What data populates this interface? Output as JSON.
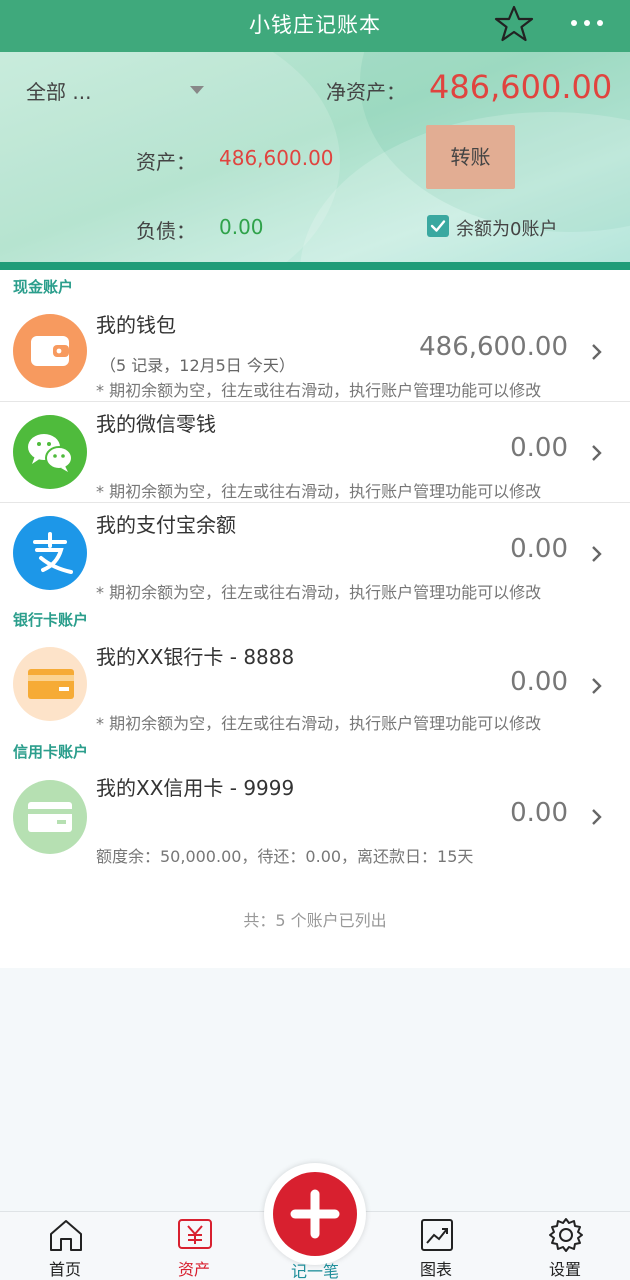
{
  "header": {
    "title": "小钱庄记账本",
    "favorite_icon": "star-icon",
    "more_icon": "more-icon"
  },
  "summary": {
    "filter_label": "全部 ...",
    "net_assets_label": "净资产：",
    "net_assets_value": "486,600.00",
    "assets_label": "资产：",
    "assets_value": "486,600.00",
    "transfer_label": "转账",
    "debt_label": "负债：",
    "debt_value": "0.00",
    "zero_balance_label": "余额为0账户",
    "zero_balance_checked": true
  },
  "sections": {
    "cash": "现金账户",
    "bank": "银行卡账户",
    "credit": "信用卡账户"
  },
  "accounts": [
    {
      "name": "我的钱包",
      "sub": "（5 记录，12月5日 今天）",
      "amount": "486,600.00",
      "note": "* 期初余额为空，往左或往右滑动，执行账户管理功能可以修改",
      "icon": "wallet-icon",
      "color": "#f79a5f"
    },
    {
      "name": "我的微信零钱",
      "amount": "0.00",
      "note": "* 期初余额为空，往左或往右滑动，执行账户管理功能可以修改",
      "icon": "wechat-icon",
      "color": "#4fbb3c"
    },
    {
      "name": "我的支付宝余额",
      "amount": "0.00",
      "note": "* 期初余额为空，往左或往右滑动，执行账户管理功能可以修改",
      "icon": "alipay-icon",
      "color": "#1d97e8"
    },
    {
      "name": "我的XX银行卡 - 8888",
      "amount": "0.00",
      "note": "* 期初余额为空，往左或往右滑动，执行账户管理功能可以修改",
      "icon": "bank-card-icon",
      "color": "#fde3c9"
    },
    {
      "name": "我的XX信用卡 - 9999",
      "amount": "0.00",
      "note": "额度余：50,000.00，待还：0.00，离还款日：15天",
      "icon": "credit-card-icon",
      "color": "#b6e0b2"
    }
  ],
  "footer": {
    "count_text": "共：5 个账户已列出"
  },
  "nav": {
    "home": "首页",
    "assets": "资产",
    "add": "记一笔",
    "charts": "图表",
    "settings": "设置",
    "active": "assets"
  },
  "colors": {
    "brand_green": "#3fa97c",
    "accent_red": "#d8202f",
    "positive_green": "#2fa24a",
    "negative_red": "#e0443f"
  }
}
